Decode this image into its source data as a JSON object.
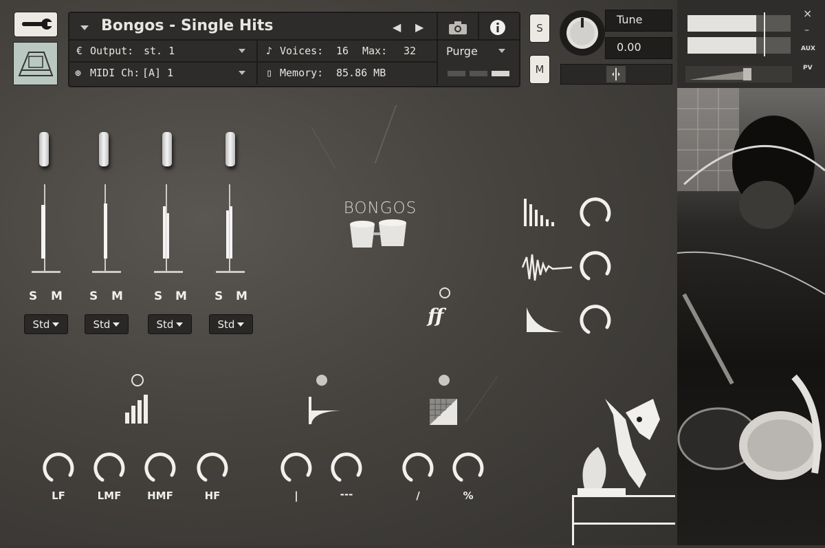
{
  "header": {
    "instrument_name": "Bongos - Single Hits",
    "output_label": "Output:",
    "output_value": "st. 1",
    "midi_label": "MIDI Ch:",
    "midi_value": "[A]  1",
    "voices_label": "Voices:",
    "voices_value": "16",
    "max_label": "Max:",
    "max_value": "32",
    "memory_label": "Memory:",
    "memory_value": "85.86 MB",
    "purge_label": "Purge"
  },
  "side_buttons": {
    "solo": "S",
    "mute": "M"
  },
  "tune": {
    "label": "Tune",
    "value": "0.00"
  },
  "right_panel": {
    "aux_label": "AUX",
    "pv_label": "PV",
    "close": "×",
    "minimize": "–"
  },
  "logo": {
    "text": "BONGOS"
  },
  "channels": [
    {
      "solo": "S",
      "mute": "M",
      "mode": "Std",
      "level": 0.62
    },
    {
      "solo": "S",
      "mute": "M",
      "mode": "Std",
      "level": 0.65
    },
    {
      "solo": "S",
      "mute": "M",
      "mode": "Std",
      "level": 0.68
    },
    {
      "solo": "S",
      "mute": "M",
      "mode": "Std",
      "level": 0.62
    }
  ],
  "dynamics_label": "ff",
  "eq_knobs": [
    "LF",
    "LMF",
    "HMF",
    "HF"
  ],
  "middle_knobs": [
    "|",
    "---"
  ],
  "right_knobs": [
    "/",
    "%"
  ],
  "colors": {
    "accent": "#e8e6e2",
    "panel": "#2e2c2a",
    "background": "#46433f"
  },
  "icons": {
    "wrench": "wrench-icon",
    "camera": "camera-icon",
    "info": "info-icon",
    "envelope_decay": "decay-icon",
    "waveform": "waveform-icon",
    "curve": "curve-icon",
    "bars": "bars-icon",
    "reverb": "reverb-icon",
    "grid": "grid-icon"
  }
}
